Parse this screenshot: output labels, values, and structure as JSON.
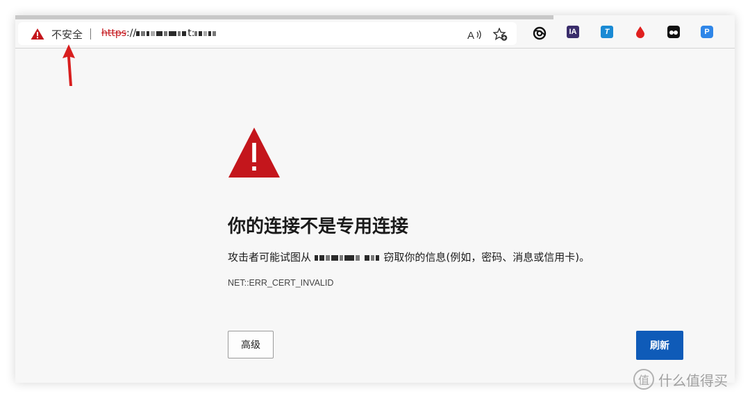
{
  "browser": {
    "security_label": "不安全",
    "url": {
      "scheme": "https",
      "rest": "://",
      "host_suffix": "t:"
    },
    "toolbar_icons": [
      "read-aloud-icon",
      "add-favorite-icon",
      "copilot-icon"
    ],
    "extensions": [
      {
        "name": "ia-extension-icon",
        "text": "IA",
        "color": "#3a2d6b"
      },
      {
        "name": "t-extension-icon",
        "text": "T",
        "color": "#1a8ad4"
      },
      {
        "name": "drop-extension-icon",
        "text": "",
        "color": "#e0201f"
      },
      {
        "name": "tampermonkey-icon",
        "text": "",
        "color": "#111111"
      },
      {
        "name": "p-extension-icon",
        "text": "P",
        "color": "#2f86e8"
      }
    ]
  },
  "error_page": {
    "headline": "你的连接不是专用连接",
    "desc_before": "攻击者可能试图从",
    "desc_after": "窃取你的信息(例如，密码、消息或信用卡)。",
    "error_code": "NET::ERR_CERT_INVALID",
    "advanced_label": "高级",
    "refresh_label": "刷新"
  },
  "colors": {
    "warning_red": "#c4161c",
    "refresh_blue": "#0f5bb8"
  },
  "watermark": {
    "text": "什么值得买",
    "icon_char": "值"
  }
}
